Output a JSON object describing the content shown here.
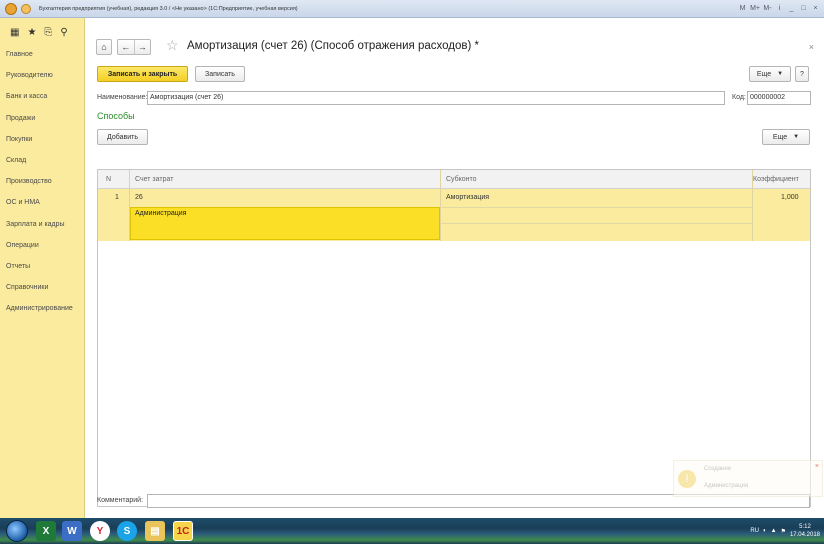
{
  "window": {
    "title": "Бухгалтерия предприятия (учебная), редакция 3.0 / <Не указано> (1С:Предприятие, учебная версия)",
    "tools": [
      "M",
      "M+",
      "M-",
      "i",
      "_",
      "□",
      "×"
    ]
  },
  "sidebar": {
    "items": [
      {
        "label": "Главное"
      },
      {
        "label": "Руководителю"
      },
      {
        "label": "Банк и касса"
      },
      {
        "label": "Продажи"
      },
      {
        "label": "Покупки"
      },
      {
        "label": "Склад"
      },
      {
        "label": "Производство"
      },
      {
        "label": "ОС и НМА"
      },
      {
        "label": "Зарплата и кадры"
      },
      {
        "label": "Операции"
      },
      {
        "label": "Отчеты"
      },
      {
        "label": "Справочники"
      },
      {
        "label": "Администрирование"
      }
    ]
  },
  "form": {
    "title": "Амортизация (счет 26) (Способ отражения расходов) *",
    "save_close_label": "Записать и закрыть",
    "save_label": "Записать",
    "more_label": "Еще",
    "help_label": "?",
    "name_label": "Наименование:",
    "name_value": "Амортизация (счет 26)",
    "code_label": "Код:",
    "code_value": "000000002",
    "section_title": "Способы",
    "add_label": "Добавить",
    "table_more_label": "Еще",
    "comment_label": "Комментарий:",
    "comment_value": ""
  },
  "table": {
    "columns": [
      "N",
      "Счет затрат",
      "Субконто",
      "Коэффициент"
    ],
    "rows": [
      {
        "n": "1",
        "account": "26",
        "subconto": "Амортизация",
        "subconto2": "Администрация",
        "coef": "1,000"
      }
    ]
  },
  "notification": {
    "title": "Создание",
    "text": "Администрация"
  },
  "taskbar": {
    "lang": "RU",
    "time": "5:12",
    "date": "17.04.2018"
  },
  "colors": {
    "sidebar_bg": "#fbeb9f",
    "primary_button": "#f4cf22",
    "selected_row": "#fbeb9f",
    "active_cell": "#fbdf27",
    "section_title": "#2b8d2b"
  }
}
